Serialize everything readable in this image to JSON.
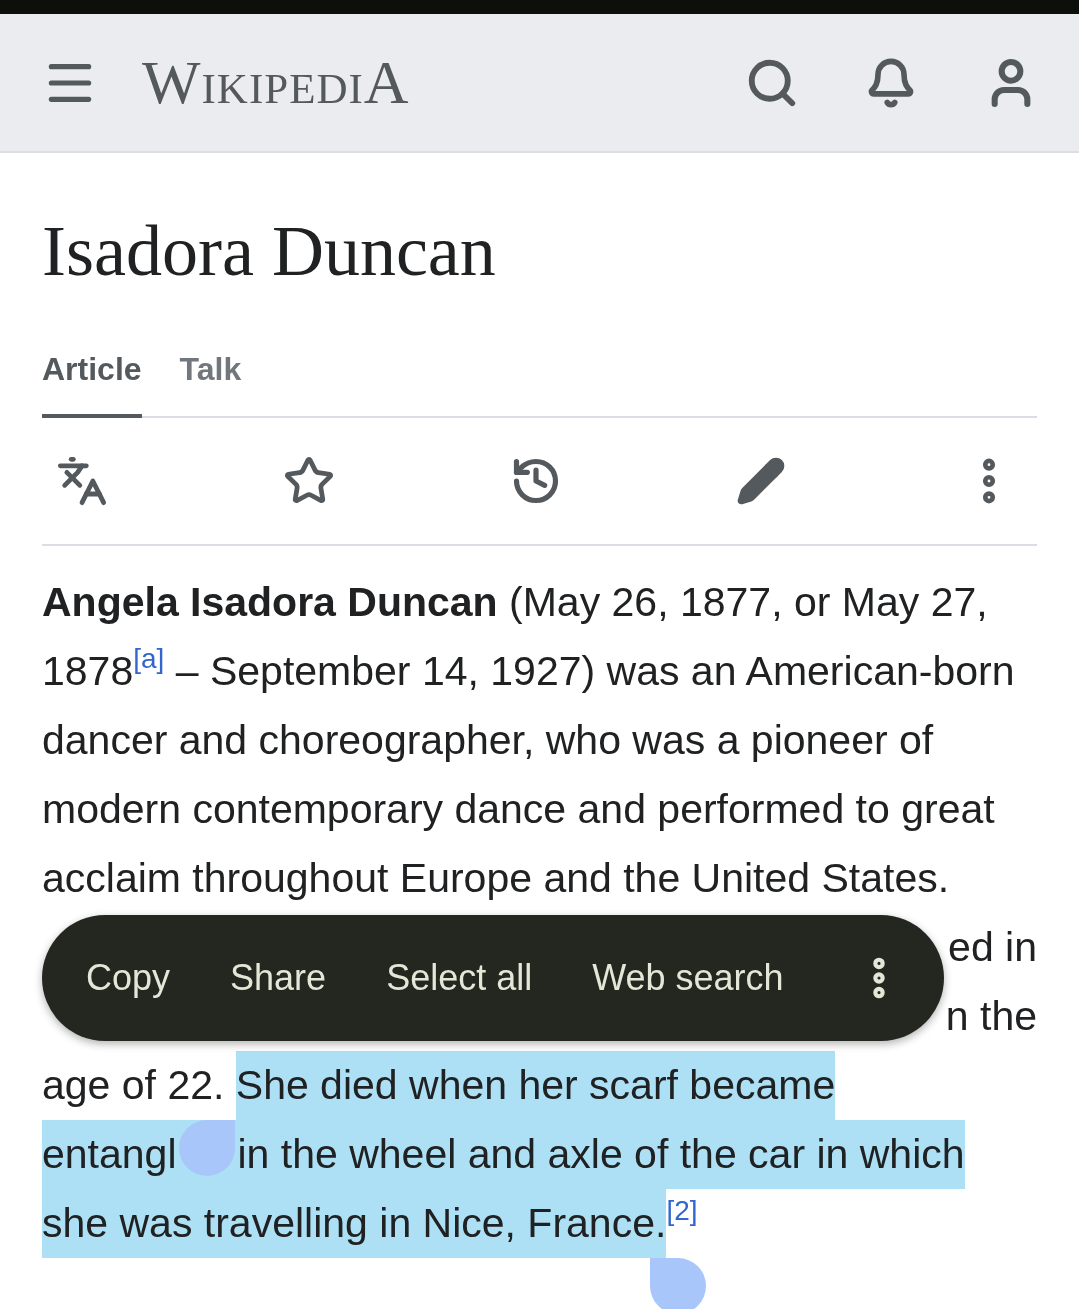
{
  "header": {
    "logo": "WikipediA"
  },
  "title": "Isadora Duncan",
  "tabs": [
    {
      "label": "Article",
      "selected": true
    },
    {
      "label": "Talk",
      "selected": false
    }
  ],
  "actions": [
    {
      "kind": "translate"
    },
    {
      "kind": "watch"
    },
    {
      "kind": "history"
    },
    {
      "kind": "edit"
    },
    {
      "kind": "more"
    }
  ],
  "paragraph": [
    {
      "segments": [
        {
          "text": "**Angela Isadora Duncan** (May 26, 1877, or May 27,",
          "selected": false
        }
      ]
    },
    {
      "segments": [
        {
          "text": "1878",
          "selected": false
        },
        {
          "text": "[a]",
          "kind": "cite",
          "selected": false
        },
        {
          "text": " – September 14, 1927) was an American-born",
          "selected": false
        }
      ]
    },
    {
      "segments": [
        {
          "text": "dancer and choreographer, who was a pioneer of",
          "selected": false
        }
      ]
    },
    {
      "segments": [
        {
          "text": "modern contemporary dance and performed to great",
          "selected": false
        }
      ]
    },
    {
      "segments": [
        {
          "text": "acclaim throughout Europe and the United States.",
          "selected": false
        }
      ]
    },
    {
      "segments": [
        {
          "text": "ed in",
          "kind": "right",
          "selected": false
        }
      ]
    },
    {
      "segments": [
        {
          "text": "n the",
          "kind": "right",
          "selected": false
        }
      ]
    },
    {
      "segments": [
        {
          "text": "age of 22. ",
          "selected": false
        },
        {
          "text": "She died when her scarf became",
          "selected": true
        }
      ]
    },
    {
      "segments": [
        {
          "text": "entangl",
          "selected": true
        },
        {
          "kind": "start-handle",
          "selected": true
        },
        {
          "text": "in the wheel and axle of the car in which",
          "selected": true
        }
      ]
    },
    {
      "segments": [
        {
          "text": "she was travelling in Nice, France.",
          "selected": true
        },
        {
          "text": "[2]",
          "kind": "cite",
          "selected": false
        },
        {
          "kind": "end-handle",
          "selected": false
        }
      ]
    }
  ],
  "context_menu": {
    "items": [
      "Copy",
      "Share",
      "Select all",
      "Web search"
    ]
  }
}
